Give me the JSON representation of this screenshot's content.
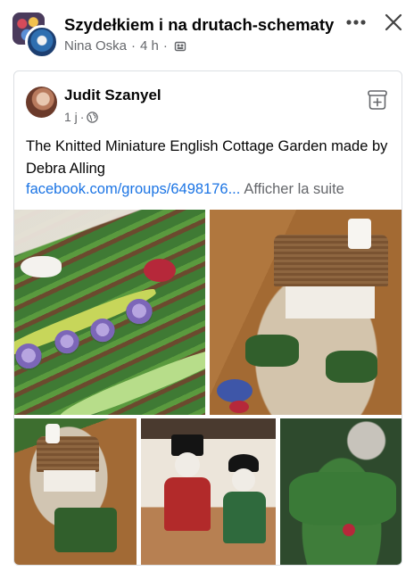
{
  "group": {
    "name": "Szydełkiem i na drutach-schematy",
    "author": "Nina Oska",
    "time": "4 h"
  },
  "shared_post": {
    "author": "Judit Szanyel",
    "time": "1 j",
    "text": "The Knitted Miniature  English Cottage Garden made by Debra Alling",
    "link": "facebook.com/groups/6498176...",
    "see_more": "Afficher la suite"
  },
  "icons": {
    "more": "more-options-icon",
    "close": "close-icon",
    "group_privacy": "group-icon",
    "audience": "globe-icon",
    "save": "save-icon"
  },
  "colors": {
    "link": "#1b74e4",
    "secondary_text": "#65676b"
  },
  "photos": [
    "knitted-vegetable-garden",
    "knitted-cottage",
    "knitted-cottage-and-beds",
    "knitted-figures",
    "knitted-garden-with-dog"
  ]
}
